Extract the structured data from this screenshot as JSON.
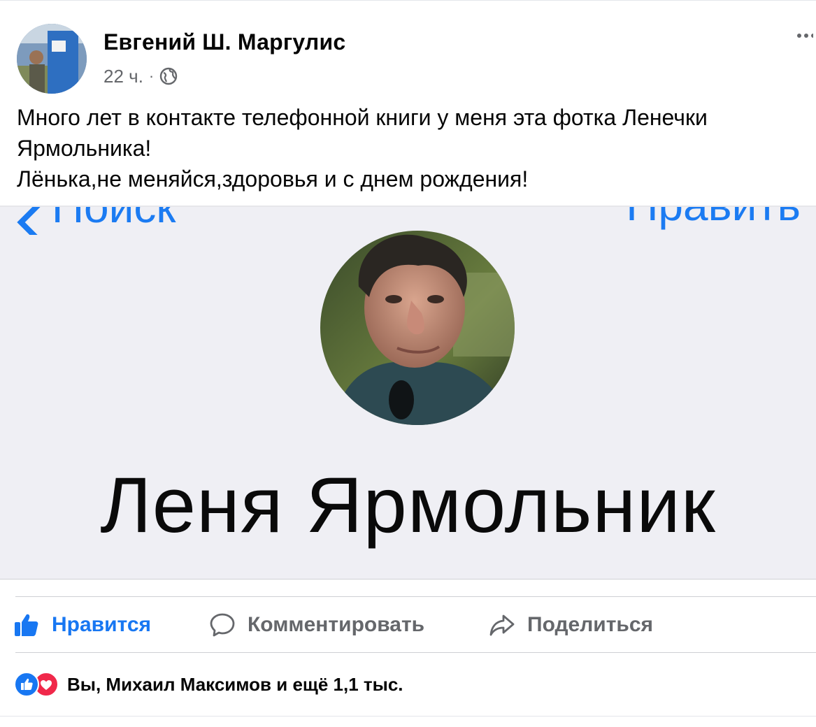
{
  "post": {
    "author": "Евгений Ш. Маргулис",
    "time": "22 ч.",
    "separator": "·",
    "text_lines": [
      "Много лет в контакте телефонной книги у меня эта фотка Ленечки",
      "Ярмольника!",
      "Лёнька,не меняйся,здоровья и с днем рождения!"
    ]
  },
  "photo": {
    "nav_back": "Поиск",
    "nav_edit": "Править",
    "contact_name": "Леня Ярмольник",
    "accent_color": "#1b7bf2"
  },
  "actions": {
    "like": "Нравится",
    "comment": "Комментировать",
    "share": "Поделиться"
  },
  "reactions": {
    "text": "Вы, Михаил Максимов и ещё 1,1 тыс.",
    "icons": [
      "like-icon",
      "love-icon"
    ]
  },
  "colors": {
    "facebook_blue": "#1877f2",
    "secondary_text": "#65676b",
    "love_red": "#f0284a"
  }
}
